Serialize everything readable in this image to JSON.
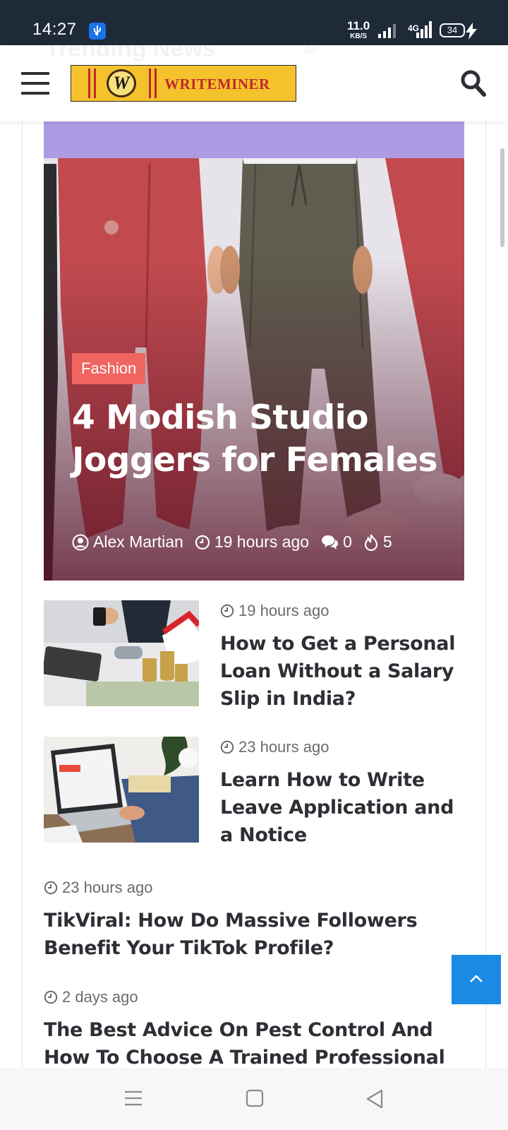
{
  "status_bar": {
    "time": "14:27",
    "net_speed": "11.0",
    "net_speed_unit": "KB/S",
    "network_type": "4G",
    "battery": "34"
  },
  "header": {
    "ghost_title": "Trending News",
    "ghost_filter": "All",
    "logo_text": "WRITEMINER",
    "logo_mark": "W"
  },
  "featured": {
    "category": "Fashion",
    "title": "4 Modish Studio Joggers for Females",
    "author": "Alex Martian",
    "time": "19 hours ago",
    "comments": "0",
    "views": "5"
  },
  "posts": [
    {
      "date": "19 hours ago",
      "title": "How to Get a Personal Loan Without a Salary Slip in India?"
    },
    {
      "date": "23 hours ago",
      "title": "Learn How to Write Leave Application and a Notice"
    },
    {
      "date": "23 hours ago",
      "title": "TikViral: How Do Massive Followers Benefit Your TikTok Profile?"
    },
    {
      "date": "2 days ago",
      "title": "The Best Advice On Pest Control And How To Choose A Trained Professional"
    }
  ],
  "colors": {
    "accent_badge": "#f06560",
    "back_to_top": "#1a8ae5",
    "logo_bg": "#f4c22b",
    "logo_text": "#c0272d"
  }
}
